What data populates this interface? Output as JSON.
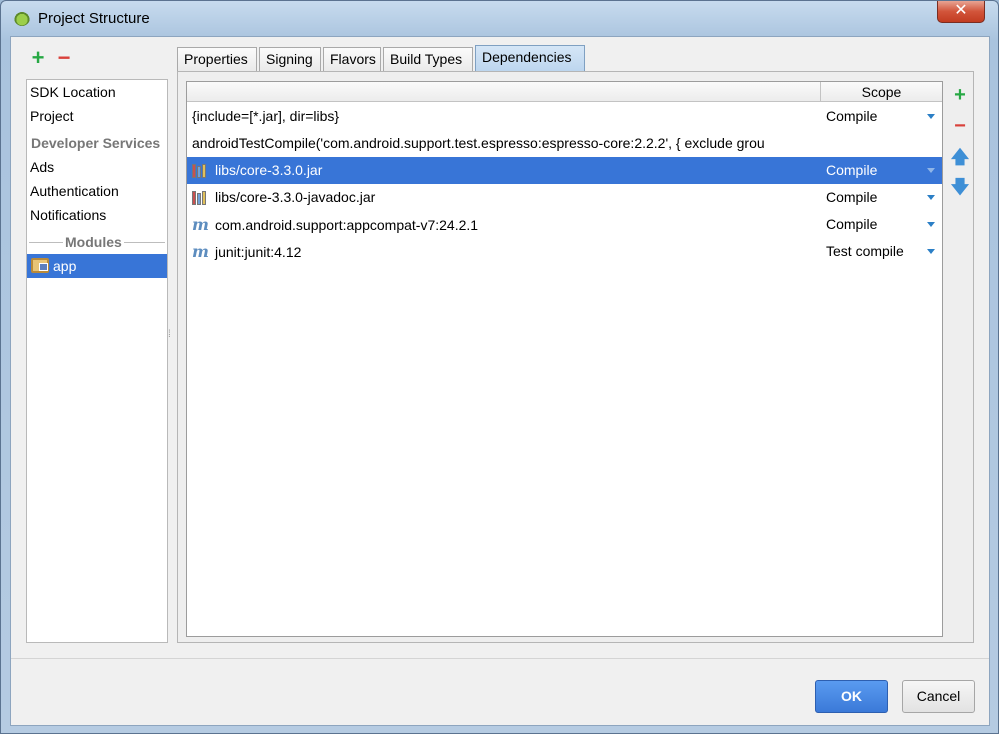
{
  "window": {
    "title": "Project Structure",
    "close_glyph": "✕"
  },
  "left_toolbar": {
    "add_glyph": "+",
    "remove_glyph": "−"
  },
  "sidebar": {
    "items_top": [
      "SDK Location",
      "Project"
    ],
    "developer_services_header": "Developer Services",
    "developer_services": [
      "Ads",
      "Authentication",
      "Notifications"
    ],
    "modules_header": "Modules",
    "modules": [
      "app"
    ]
  },
  "tabs": [
    "Properties",
    "Signing",
    "Flavors",
    "Build Types",
    "Dependencies"
  ],
  "active_tab": "Dependencies",
  "table": {
    "scope_header": "Scope",
    "rows": [
      {
        "name": "{include=[*.jar], dir=libs}",
        "scope": "Compile",
        "icon": "none"
      },
      {
        "name": "androidTestCompile('com.android.support.test.espresso:espresso-core:2.2.2', {        exclude grou",
        "scope": "",
        "icon": "none"
      },
      {
        "name": "libs/core-3.3.0.jar",
        "scope": "Compile",
        "icon": "jar-library-icon"
      },
      {
        "name": "libs/core-3.3.0-javadoc.jar",
        "scope": "Compile",
        "icon": "jar-library-icon"
      },
      {
        "name": "com.android.support:appcompat-v7:24.2.1",
        "scope": "Compile",
        "icon": "maven-icon"
      },
      {
        "name": "junit:junit:4.12",
        "scope": "Test compile",
        "icon": "maven-icon"
      }
    ],
    "maven_glyph": "m"
  },
  "side_tools": {
    "add_glyph": "+",
    "remove_glyph": "−",
    "up_glyph": "🡅",
    "down_glyph": "🡇"
  },
  "footer": {
    "ok_label": "OK",
    "cancel_label": "Cancel"
  },
  "colors": {
    "selection": "#3875d7",
    "add": "#27a844",
    "remove": "#d9413b",
    "ok": "#3b79d8"
  }
}
